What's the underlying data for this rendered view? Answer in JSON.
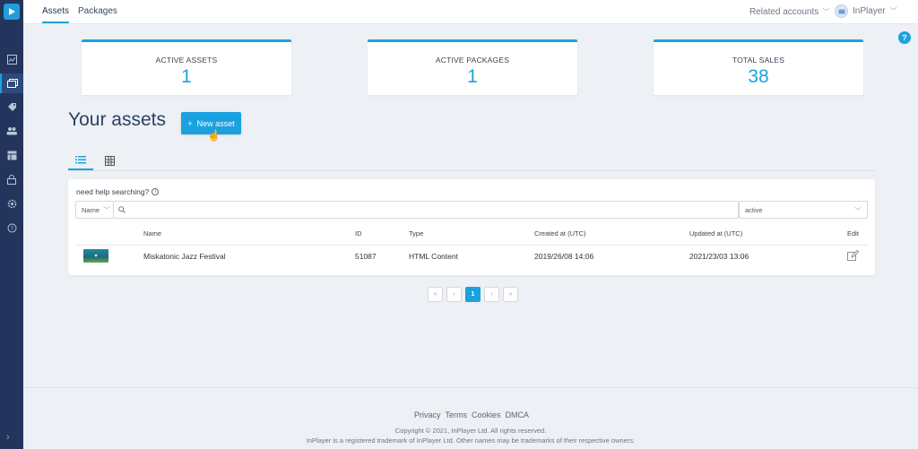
{
  "top_tabs": [
    {
      "label": "Assets",
      "active": true
    },
    {
      "label": "Packages",
      "active": false
    }
  ],
  "header": {
    "related_accounts": "Related accounts",
    "user_name": "InPlayer"
  },
  "help_button": "?",
  "stats": [
    {
      "label": "ACTIVE ASSETS",
      "value": "1"
    },
    {
      "label": "ACTIVE PACKAGES",
      "value": "1"
    },
    {
      "label": "TOTAL SALES",
      "value": "38"
    }
  ],
  "page_title": "Your assets",
  "new_asset_button": "New asset",
  "search": {
    "help": "need help searching?",
    "field_select": "Name",
    "placeholder": "",
    "status_select": "active"
  },
  "table": {
    "columns": [
      "Name",
      "ID",
      "Type",
      "Created at (UTC)",
      "Updated at (UTC)",
      "Edit"
    ],
    "rows": [
      {
        "name": "Miskatonic Jazz Festival",
        "id": "51087",
        "type": "HTML Content",
        "created": "2019/26/08 14:06",
        "updated": "2021/23/03 13:06"
      }
    ]
  },
  "pagination": {
    "first": "«",
    "prev": "‹",
    "current": "1",
    "next": "›",
    "last": "»"
  },
  "footer": {
    "links": [
      "Privacy",
      "Terms",
      "Cookies",
      "DMCA"
    ],
    "copyright": "Copyright © 2021, InPlayer Ltd. All rights reserved.",
    "trademark": "InPlayer is a registered trademark of InPlayer Ltd. Other names may be trademarks of their respective owners."
  },
  "colors": {
    "accent": "#1aa2e0",
    "sidebar": "#23355c",
    "background": "#edf0f4"
  },
  "icons": [
    "logo-icon",
    "analytics-icon",
    "assets-icon",
    "tag-icon",
    "users-icon",
    "reports-icon",
    "lock-icon",
    "settings-icon",
    "help-icon",
    "list-view-icon",
    "grid-view-icon",
    "search-icon",
    "edit-icon"
  ]
}
